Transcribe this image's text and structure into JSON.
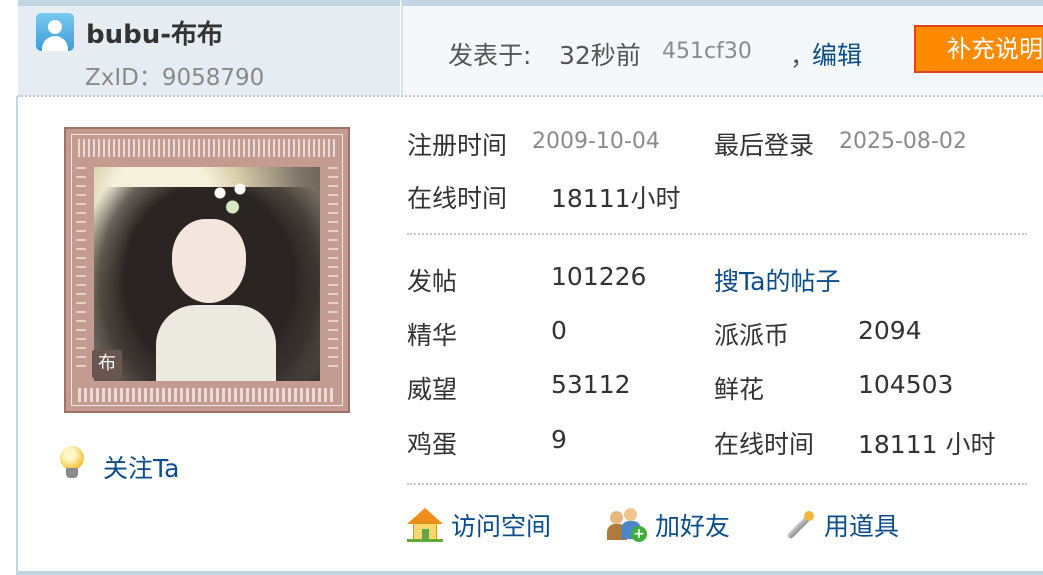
{
  "user": {
    "name": "bubu-布布",
    "zxid": "ZxID：9058790",
    "avatar_char": "布",
    "follow_label": "关注Ta"
  },
  "post": {
    "posted_label": "发表于:",
    "posted_time": "32秒前",
    "hash": "451cf30",
    "edit_comma": "，",
    "edit_label": "编辑",
    "supplement_label": "补充说明"
  },
  "profile": {
    "register_label": "注册时间",
    "register_date": "2009-10-04",
    "last_login_label": "最后登录",
    "last_login_date": "2025-08-02",
    "online_label": "在线时间",
    "online_value": "18111小时"
  },
  "stats": {
    "posts_label": "发帖",
    "posts_value": "101226",
    "search_posts_link": "搜Ta的帖子",
    "digest_label": "精华",
    "digest_value": "0",
    "coins_label": "派派币",
    "coins_value": "2094",
    "prestige_label": "威望",
    "prestige_value": "53112",
    "flowers_label": "鲜花",
    "flowers_value": "104503",
    "eggs_label": "鸡蛋",
    "eggs_value": "9",
    "online_label": "在线时间",
    "online_value": "18111 小时"
  },
  "actions": {
    "visit_space": "访问空间",
    "add_friend": "加好友",
    "use_item": "用道具"
  },
  "colors": {
    "link": "#0b4d8a",
    "header_bg": "#e5edf2",
    "button_orange": "#ff8a00",
    "border_blue": "#c2d5e3"
  },
  "icons": [
    "user-icon",
    "lightbulb-icon",
    "home-icon",
    "add-friend-icon",
    "magic-wand-icon"
  ]
}
